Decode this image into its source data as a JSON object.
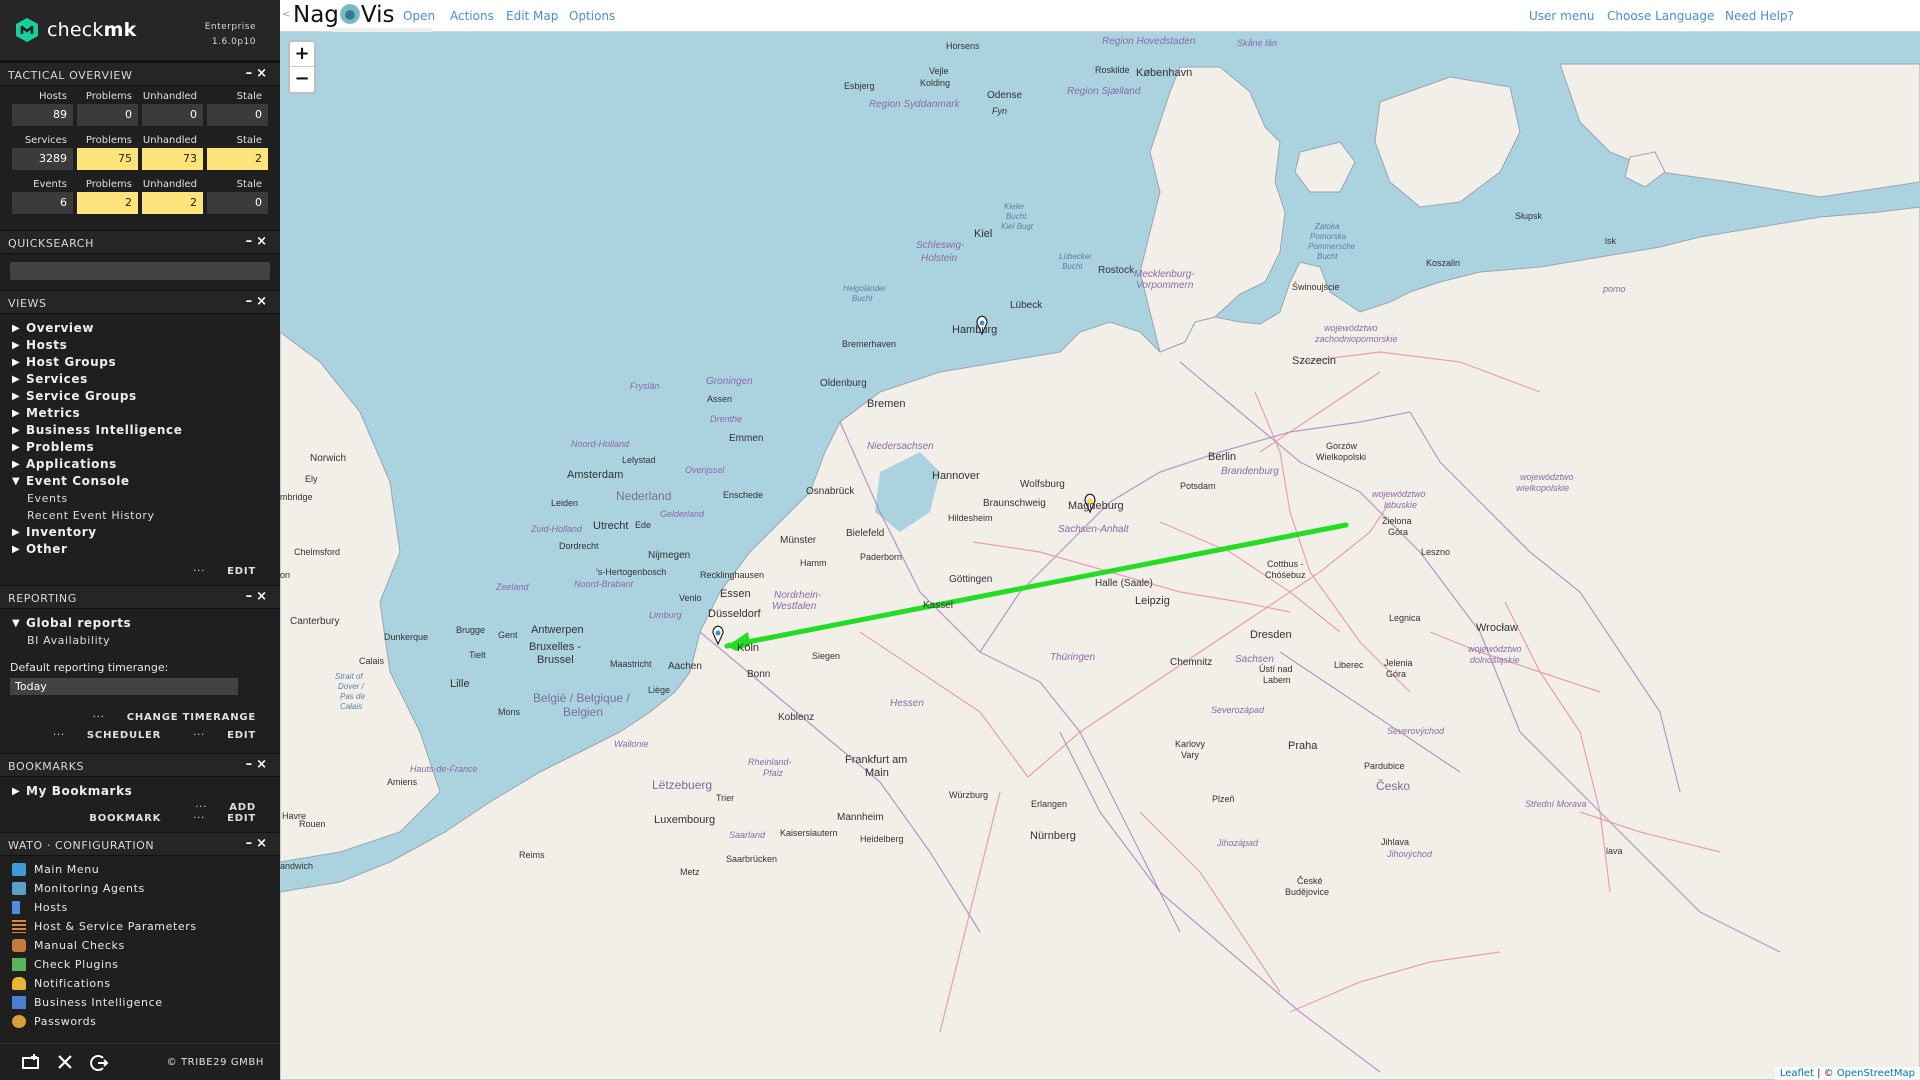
{
  "sidebar": {
    "brand": "checkmk",
    "edition": "Enterprise",
    "version": "1.6.0p10",
    "tactical_overview": {
      "title": "TACTICAL OVERVIEW",
      "rows": [
        {
          "labels": [
            "Hosts",
            "Problems",
            "Unhandled",
            "Stale"
          ],
          "values": [
            "89",
            "0",
            "0",
            "0"
          ],
          "warn": [
            false,
            false,
            false,
            false
          ]
        },
        {
          "labels": [
            "Services",
            "Problems",
            "Unhandled",
            "Stale"
          ],
          "values": [
            "3289",
            "75",
            "73",
            "2"
          ],
          "warn": [
            false,
            true,
            true,
            true
          ]
        },
        {
          "labels": [
            "Events",
            "Problems",
            "Unhandled",
            "Stale"
          ],
          "values": [
            "6",
            "2",
            "2",
            "0"
          ],
          "warn": [
            false,
            true,
            true,
            false
          ]
        }
      ]
    },
    "quicksearch": {
      "title": "QUICKSEARCH"
    },
    "views": {
      "title": "VIEWS",
      "items": [
        "Overview",
        "Hosts",
        "Host Groups",
        "Services",
        "Service Groups",
        "Metrics",
        "Business Intelligence",
        "Problems",
        "Applications",
        "Event Console",
        "Inventory",
        "Other"
      ],
      "event_console_sub": [
        "Events",
        "Recent Event History"
      ],
      "edit": "EDIT"
    },
    "reporting": {
      "title": "REPORTING",
      "global_reports": "Global reports",
      "bi_availability": "BI Availability",
      "timerange_label": "Default reporting timerange:",
      "timerange_value": "Today",
      "change_timerange": "CHANGE TIMERANGE",
      "scheduler": "SCHEDULER",
      "edit": "EDIT"
    },
    "bookmarks": {
      "title": "BOOKMARKS",
      "my_bookmarks": "My Bookmarks",
      "add_bookmark": "ADD BOOKMARK",
      "edit": "EDIT"
    },
    "wato": {
      "title": "WATO · CONFIGURATION",
      "items": [
        {
          "label": "Main Menu",
          "icon": "main-menu-icon",
          "color": "#3d9bd9"
        },
        {
          "label": "Monitoring Agents",
          "icon": "agents-icon",
          "color": "#5aa0c8"
        },
        {
          "label": "Hosts",
          "icon": "hosts-icon",
          "color": "#4a90d9"
        },
        {
          "label": "Host & Service Parameters",
          "icon": "rulesets-icon",
          "color": "#d98a3a"
        },
        {
          "label": "Manual Checks",
          "icon": "manual-checks-icon",
          "color": "#c87a3a"
        },
        {
          "label": "Check Plugins",
          "icon": "check-plugins-icon",
          "color": "#5ab55a"
        },
        {
          "label": "Notifications",
          "icon": "notifications-icon",
          "color": "#e8b832"
        },
        {
          "label": "Business Intelligence",
          "icon": "bi-icon",
          "color": "#4a7fd0"
        },
        {
          "label": "Passwords",
          "icon": "passwords-icon",
          "color": "#d9a03a"
        }
      ]
    },
    "copyright": "© TRIBE29 GMBH"
  },
  "nagvis": {
    "back": "<",
    "logo_left": "Nag",
    "logo_right": "Vis",
    "menu": [
      "Open",
      "Actions",
      "Edit Map",
      "Options"
    ],
    "right_menu": [
      "User menu",
      "Choose Language",
      "Need Help?"
    ]
  },
  "map": {
    "zoom_in": "+",
    "zoom_out": "−",
    "attribution_leaflet": "Leaflet",
    "attribution_sep": " | © ",
    "attribution_osm": "OpenStreetMap",
    "line_color": "#22dd22",
    "labels": {
      "hamburg": "Hamburg",
      "bremen": "Bremen",
      "hannover": "Hannover",
      "berlin": "Berlin",
      "magdeburg": "Magdeburg",
      "leipzig": "Leipzig",
      "dresden": "Dresden",
      "koeln": "Köln",
      "bonn": "Bonn",
      "dusseldorf": "Düsseldorf",
      "essen": "Essen",
      "frankfurt1": "Frankfurt am",
      "frankfurt2": "Main",
      "amsterdam": "Amsterdam",
      "nederland": "Nederland",
      "utrecht": "Utrecht",
      "antwerpen": "Antwerpen",
      "bruxelles1": "Bruxelles -",
      "bruxelles2": "Brussel",
      "belgie1": "België / Belgique /",
      "belgie2": "Belgien",
      "letzebuerg": "Lëtzebuerg",
      "luxembourg": "Luxembourg",
      "kobenhavn": "København",
      "kiel": "Kiel",
      "lubeck": "Lübeck",
      "rostock": "Rostock",
      "szczecin": "Szczecin",
      "praha": "Praha",
      "cesko": "Česko",
      "wroclaw": "Wrocław",
      "nurnberg": "Nürnberg",
      "kassel": "Kassel",
      "gottingen": "Göttingen",
      "munster": "Münster",
      "bielefeld": "Bielefeld",
      "osnabruck": "Osnabrück",
      "wolfsburg": "Wolfsburg",
      "braunschweig": "Braunschweig",
      "halle": "Halle (Saale)",
      "chemnitz": "Chemnitz",
      "koblenz": "Koblenz",
      "mannheim": "Mannheim",
      "aachen": "Aachen",
      "lille": "Lille",
      "norwich": "Norwich",
      "canterbury": "Canterbury",
      "groningen": "Groningen",
      "oldenburg": "Oldenburg",
      "emmen": "Emmen",
      "nijmegen": "Nijmegen",
      "niedersachsen": "Niedersachsen",
      "brandenburg": "Brandenburg",
      "sachsen": "Sachsen",
      "thuringen": "Thüringen",
      "hessen": "Hessen",
      "sachsen_anhalt": "Sachsen-Anhalt",
      "schleswig1": "Schleswig-",
      "schleswig2": "Holstein",
      "mecklenburg1": "Mecklenburg-",
      "mecklenburg2": "Vorpommern",
      "nrw1": "Nordrhein-",
      "nrw2": "Westfalen",
      "region_syddanmark": "Region Syddanmark",
      "region_sjaelland": "Region Sjælland",
      "region_hovedstaden": "Region Hovedstaden",
      "fyn": "Fyn",
      "odense": "Odense",
      "horsens": "Horsens",
      "vejle": "Vejle",
      "kolding": "Kolding",
      "esbjerg": "Esbjerg",
      "roskilde": "Roskilde",
      "slupsk": "Słupsk",
      "koszalin": "Koszalin",
      "swinoujscie": "Świnoujście",
      "zachodniopomorskie1": "województwo",
      "zachodniopomorskie2": "zachodniopomorskie",
      "lubuskie1": "województwo",
      "lubuskie2": "lubuskie",
      "wielkopolskie1": "województwo",
      "wielkopolskie2": "wielkopolskie",
      "dolnoslaskie1": "województwo",
      "dolnoslaskie2": "dolnośląskie",
      "gorzow1": "Gorzów",
      "gorzow2": "Wielkopolski",
      "zielona1": "Zielona",
      "zielona2": "Góra",
      "leszno": "Leszno",
      "legnica": "Legnica",
      "cottbus1": "Cottbus -",
      "cottbus2": "Chóśebuz",
      "potsdam": "Potsdam",
      "liberec": "Liberec",
      "jelenia1": "Jelenia",
      "jelenia2": "Góra",
      "usti1": "Ústí nad",
      "usti2": "Labem",
      "karlovy1": "Karlovy",
      "karlovy2": "Vary",
      "pardubice": "Pardubice",
      "plzen": "Plzeň",
      "jihlava": "Jihlava",
      "ceske1": "České",
      "ceske2": "Budějovice",
      "severozapad": "Severozápad",
      "severovychod": "Severovýchod",
      "jihozapad": "Jihozápad",
      "jihovychod": "Jihovýchod",
      "stredni_morava": "Střední Morava",
      "erlangen": "Erlangen",
      "wurzburg": "Würzburg",
      "heidelberg": "Heidelberg",
      "kaiserslautern": "Kaiserslautern",
      "saarbrucken": "Saarbrücken",
      "saarland": "Saarland",
      "trier": "Trier",
      "metz": "Metz",
      "reims": "Reims",
      "amiens": "Amiens",
      "rouen": "Rouen",
      "havre": "Havre",
      "calais": "Calais",
      "dunkerque": "Dunkerque",
      "brugge": "Brugge",
      "gent": "Gent",
      "tielt": "Tielt",
      "mons": "Mons",
      "liege": "Liège",
      "maastricht": "Maastricht",
      "wallonie": "Wallonie",
      "hauts1": "Hauts-de-France",
      "rheinland1": "Rheinland-",
      "rheinland2": "Pfalz",
      "zeeland": "Zeeland",
      "noord_brabant": "Noord-Brabant",
      "limburg": "Limburg",
      "zuid_holland": "Zuid-Holland",
      "noord_holland": "Noord-Holland",
      "gelderland": "Gelderland",
      "overijssel": "Overijssel",
      "drenthe": "Drenthe",
      "fryslan": "Fryslân",
      "leiden": "Leiden",
      "ede": "Ede",
      "dordrecht": "Dordrecht",
      "hertogenbosch": "'s-Hertogenbosch",
      "venlo": "Venlo",
      "recklinghausen": "Recklinghausen",
      "hamm": "Hamm",
      "paderborn": "Paderborn",
      "siegen": "Siegen",
      "enschede": "Enschede",
      "lelystad": "Lelystad",
      "assen": "Assen",
      "bremerhaven": "Bremerhaven",
      "hildesheim": "Hildesheim",
      "helgolander1": "Helgoländer",
      "helgolander2": "Bucht",
      "kieler1": "Kieler",
      "kieler2": "Bucht",
      "kieler3": "Kiel Bugt",
      "lubecker1": "Lübecker",
      "lubecker2": "Bucht",
      "zatoka1": "Zatoka",
      "zatoka2": "Pomorska",
      "zatoka3": "Pommersche",
      "zatoka4": "Bucht",
      "skane": "Skåne län",
      "ely": "Ely",
      "chelmsford": "Chelmsford",
      "strait1": "Strait of",
      "strait2": "Dover /",
      "strait3": "Pas de",
      "strait4": "Calais",
      "ambridge": "mbridge",
      "on": "on",
      "andwich": "andwich",
      "pomo": "pomo",
      "lsk": "lsk",
      "lava": "lava"
    }
  }
}
